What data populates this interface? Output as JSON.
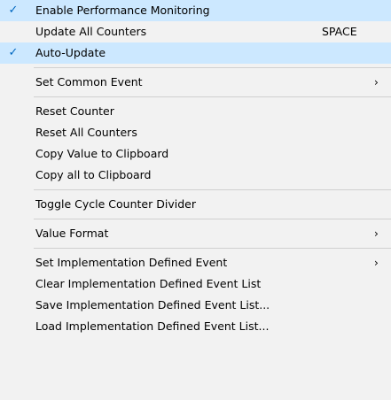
{
  "menu": {
    "items": [
      {
        "label": "Enable Performance Monitoring",
        "checked": true
      },
      {
        "label": "Update All Counters",
        "shortcut": "SPACE"
      },
      {
        "label": "Auto-Update",
        "checked": true
      },
      {
        "separator": true
      },
      {
        "label": "Set Common Event",
        "submenu": true
      },
      {
        "separator": true
      },
      {
        "label": "Reset Counter"
      },
      {
        "label": "Reset All Counters"
      },
      {
        "label": "Copy Value to Clipboard"
      },
      {
        "label": "Copy all to Clipboard"
      },
      {
        "separator": true
      },
      {
        "label": "Toggle Cycle Counter Divider"
      },
      {
        "separator": true
      },
      {
        "label": "Value Format",
        "submenu": true
      },
      {
        "separator": true
      },
      {
        "label": "Set Implementation Defined Event",
        "submenu": true
      },
      {
        "label": "Clear Implementation Defined Event List"
      },
      {
        "label": "Save Implementation Defined Event List..."
      },
      {
        "label": "Load Implementation Defined Event List..."
      }
    ],
    "check_glyph": "✓",
    "submenu_glyph": "›",
    "check_color": "#0067c0",
    "highlight_color": "#cce8ff"
  }
}
